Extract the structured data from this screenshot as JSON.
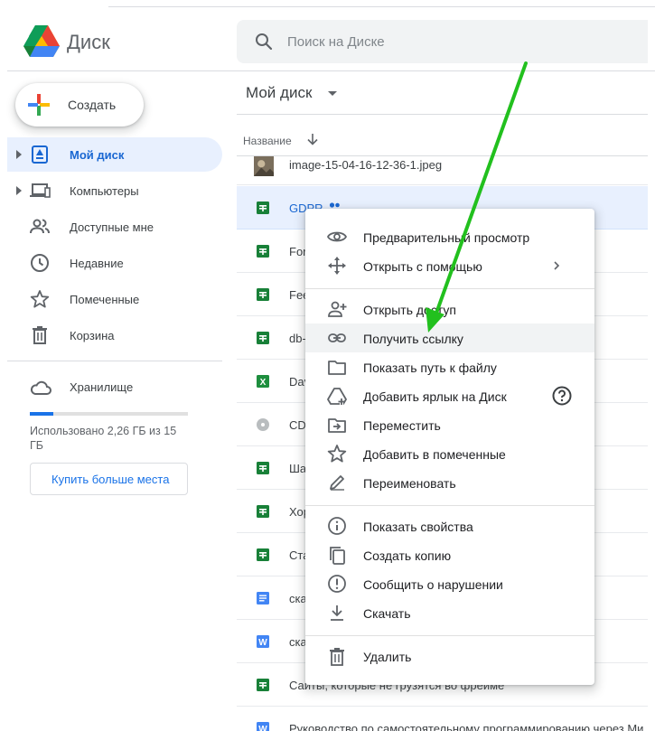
{
  "app": {
    "title": "Диск"
  },
  "search": {
    "placeholder": "Поиск на Диске"
  },
  "sidebar": {
    "create_label": "Создать",
    "items": [
      {
        "label": "Мой диск"
      },
      {
        "label": "Компьютеры"
      },
      {
        "label": "Доступные мне"
      },
      {
        "label": "Недавние"
      },
      {
        "label": "Помеченные"
      },
      {
        "label": "Корзина"
      }
    ],
    "storage": {
      "title": "Хранилище",
      "used_text": "Использовано 2,26 ГБ из 15 ГБ",
      "used_fraction": 0.15,
      "buy_label": "Купить больше места"
    }
  },
  "main": {
    "title": "Мой диск",
    "column_name": "Название",
    "files": [
      {
        "name": "image-15-04-16-12-36-1.jpeg",
        "type": "image"
      },
      {
        "name": "GDPR",
        "type": "sheet",
        "shared": true
      },
      {
        "name": "For",
        "type": "sheet"
      },
      {
        "name": "Fee",
        "type": "sheet"
      },
      {
        "name": "db-",
        "type": "sheet"
      },
      {
        "name": "Dav",
        "type": "excel"
      },
      {
        "name": "CD",
        "type": "disc"
      },
      {
        "name": "Ша",
        "type": "sheet"
      },
      {
        "name": "Хор",
        "type": "sheet"
      },
      {
        "name": "Ста",
        "type": "sheet"
      },
      {
        "name": "ска",
        "type": "doc"
      },
      {
        "name": "ска",
        "type": "word"
      },
      {
        "name": "Сайты, которые не грузятся во фрейме",
        "type": "sheet"
      },
      {
        "name": "Руководство по самостоятельному программированию через Ми",
        "type": "word"
      }
    ]
  },
  "context_menu": {
    "items": [
      {
        "label": "Предварительный просмотр",
        "icon": "eye-icon"
      },
      {
        "label": "Открыть с помощью",
        "icon": "move-icon",
        "submenu": true
      },
      {
        "label": "Открыть доступ",
        "icon": "person-add-icon"
      },
      {
        "label": "Получить ссылку",
        "icon": "link-icon",
        "highlighted": true
      },
      {
        "label": "Показать путь к файлу",
        "icon": "folder-icon"
      },
      {
        "label": "Добавить ярлык на Диск",
        "icon": "drive-shortcut-icon",
        "help": true
      },
      {
        "label": "Переместить",
        "icon": "move-to-folder-icon"
      },
      {
        "label": "Добавить в помеченные",
        "icon": "star-icon"
      },
      {
        "label": "Переименовать",
        "icon": "pencil-icon"
      },
      {
        "label": "Показать свойства",
        "icon": "info-icon"
      },
      {
        "label": "Создать копию",
        "icon": "copy-icon"
      },
      {
        "label": "Сообщить о нарушении",
        "icon": "report-icon"
      },
      {
        "label": "Скачать",
        "icon": "download-icon"
      },
      {
        "label": "Удалить",
        "icon": "trash-icon"
      }
    ]
  },
  "colors": {
    "accent": "#1a73e8",
    "active_nav_bg": "#e8f0fe",
    "sheets_green": "#188038",
    "annotation_arrow": "#22c01e"
  }
}
